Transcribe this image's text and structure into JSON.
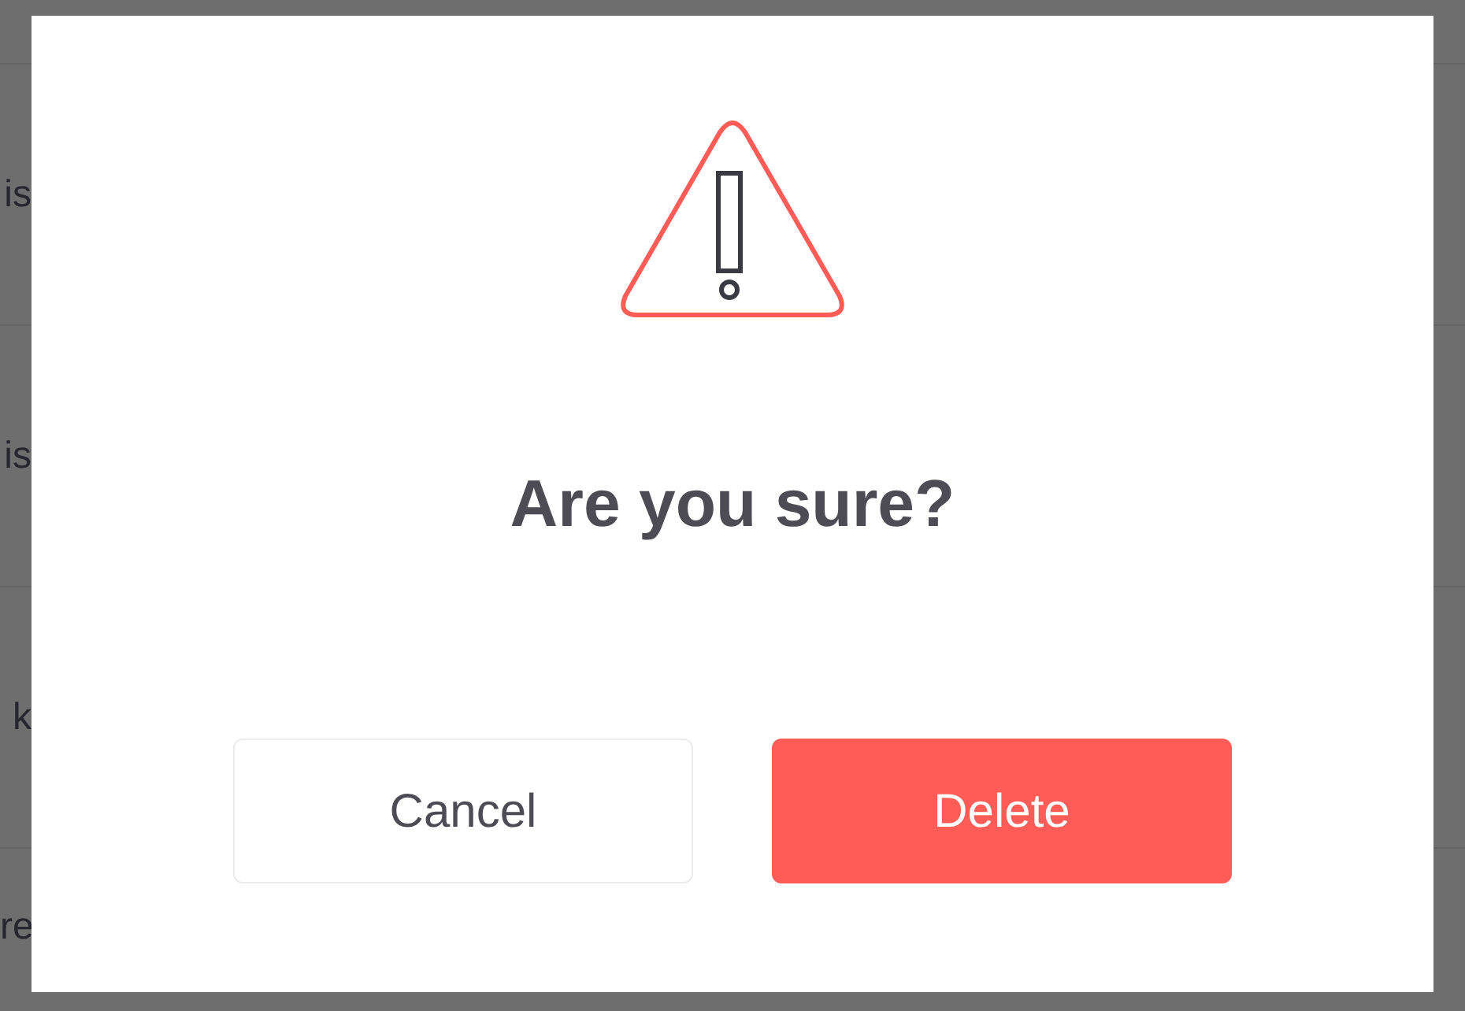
{
  "background_rows": [
    {
      "text": "is"
    },
    {
      "text": "is"
    },
    {
      "text": "k"
    },
    {
      "text": "re"
    }
  ],
  "dialog": {
    "title": "Are you sure?",
    "buttons": [
      {
        "label": "Cancel",
        "kind": "secondary"
      },
      {
        "label": "Delete",
        "kind": "danger"
      }
    ]
  }
}
